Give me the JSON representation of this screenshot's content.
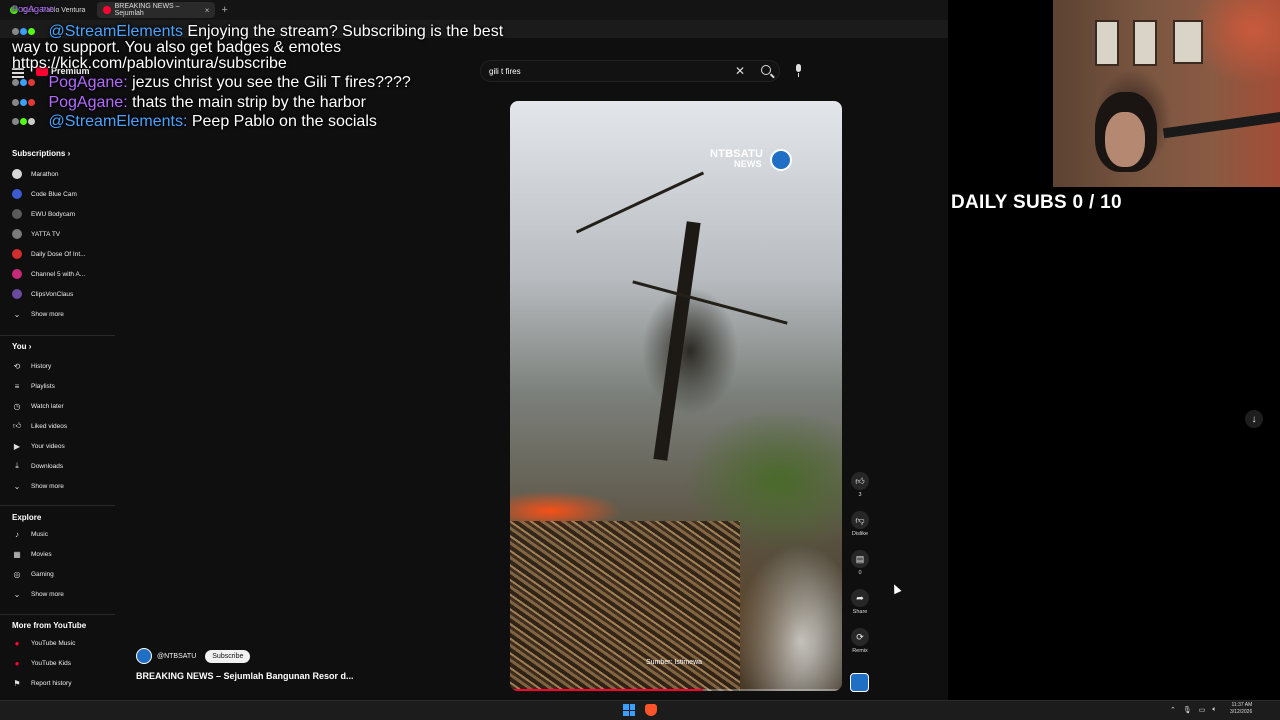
{
  "browser": {
    "tabs": [
      {
        "label": "Kick - Pablo Ventura"
      },
      {
        "label": "BREAKING NEWS – Sejumlah"
      }
    ],
    "new_tab": "+",
    "close": "×"
  },
  "youtube": {
    "logo_text": "Premium",
    "search_value": "gili t fires",
    "sidebar": {
      "subscriptions_heading": "Subscriptions",
      "subscriptions": [
        {
          "label": "Marathon",
          "color": "#d8d8d8"
        },
        {
          "label": "Code Blue Cam",
          "color": "#3b5bd1"
        },
        {
          "label": "EWU Bodycam",
          "color": "#5a5a5a"
        },
        {
          "label": "YATTA TV",
          "color": "#7a7a7a"
        },
        {
          "label": "Daily Dose Of Int...",
          "color": "#d02d2d"
        },
        {
          "label": "Channel 5 with A...",
          "color": "#c82a7a"
        },
        {
          "label": "ClipsVonClaus",
          "color": "#6a4aa0"
        }
      ],
      "show_more": "Show more",
      "you_heading": "You",
      "you_items": [
        "History",
        "Playlists",
        "Watch later",
        "Liked videos",
        "Your videos",
        "Downloads",
        "Show more"
      ],
      "explore_heading": "Explore",
      "explore_items": [
        "Music",
        "Movies",
        "Gaming",
        "Show more"
      ],
      "more_heading": "More from YouTube",
      "more_items": [
        "YouTube Music",
        "YouTube Kids",
        "Report history"
      ]
    },
    "video": {
      "watermark_line1": "NTBSATU",
      "watermark_line2": "NEWS",
      "credit": "Sumber: Istimewa",
      "progress_fraction": 0.58,
      "channel": "@NTBSATU",
      "subscribe": "Subscribe",
      "title": "BREAKING NEWS – Sejumlah Bangunan Resor d..."
    },
    "actions": {
      "like_count": "3",
      "dislike_label": "Dislike",
      "comment_count": "0",
      "share_label": "Share",
      "remix_label": "Remix"
    }
  },
  "chat": {
    "lines": [
      {
        "user": "PogAgane",
        "msg": ""
      },
      {
        "user": "@StreamElements",
        "msg": "Enjoying the stream? Subscribing is the best"
      },
      {
        "user": "",
        "msg": "way to support. You also get badges & emotes"
      },
      {
        "user": "",
        "msg": "https://kick.com/pablovintura/subscribe"
      },
      {
        "user": "PogAgane:",
        "msg": "jezus christ you see the Gili T fires????"
      },
      {
        "user": "PogAgane:",
        "msg": "thats the main strip by the harbor"
      },
      {
        "user": "@StreamElements:",
        "msg": "Peep Pablo on the socials"
      }
    ]
  },
  "overlay": {
    "daily_subs": "DAILY SUBS 0 / 10"
  },
  "taskbar": {
    "time": "11:37 AM",
    "date": "3/12/2026"
  }
}
